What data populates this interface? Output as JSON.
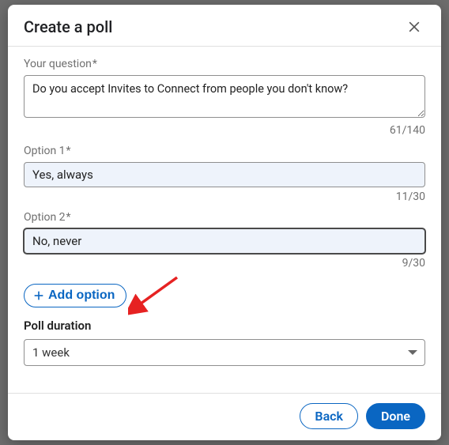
{
  "modal": {
    "title": "Create a poll"
  },
  "question": {
    "label": "Your question",
    "required_marker": "*",
    "value": "Do you accept Invites to Connect from people you don't know?",
    "counter": "61/140"
  },
  "options": [
    {
      "label": "Option 1",
      "required_marker": "*",
      "value": "Yes, always",
      "counter": "11/30"
    },
    {
      "label": "Option 2",
      "required_marker": "*",
      "value": "No, never",
      "counter": "9/30"
    }
  ],
  "add_option": {
    "label": "Add option"
  },
  "duration": {
    "label": "Poll duration",
    "value": "1 week"
  },
  "footer": {
    "back": "Back",
    "done": "Done"
  }
}
